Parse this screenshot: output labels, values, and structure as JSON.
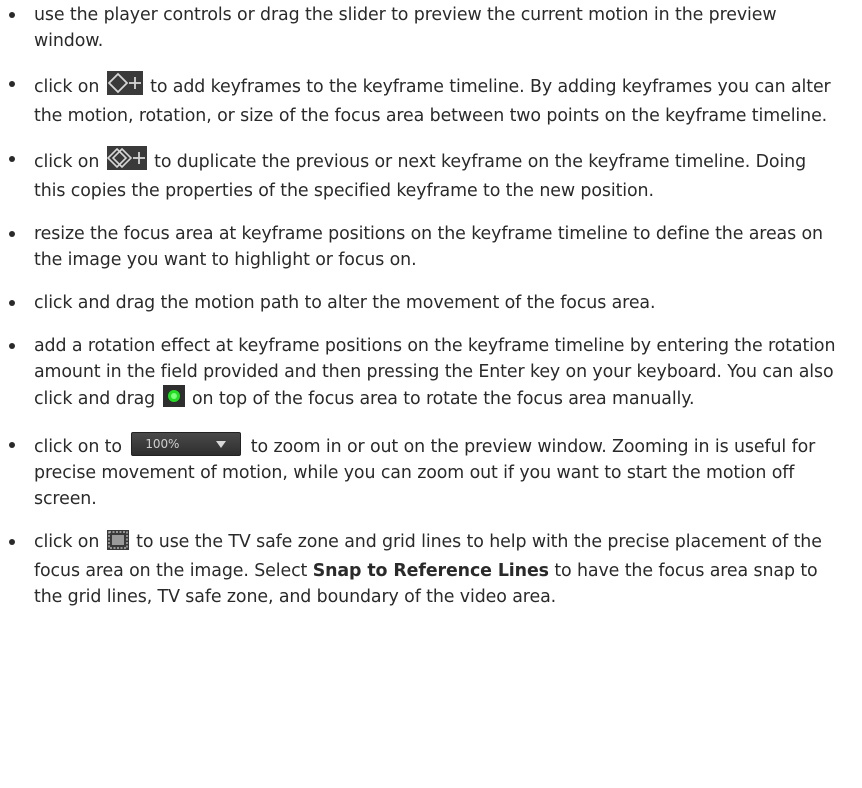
{
  "colors": {
    "text": "#2a2a2a",
    "icon_gray": "#d0d0d0",
    "icon_dark_bg": "#3a3a3a",
    "rotate_handle": "#22dd22"
  },
  "icons": {
    "add_keyframe": "add-keyframe-icon",
    "duplicate_keyframe": "duplicate-keyframe-icon",
    "rotate_handle": "rotate-handle-icon",
    "zoom_dropdown": "zoom-dropdown",
    "safe_zone": "tv-safe-zone-icon"
  },
  "bullets": [
    {
      "text": "use the player controls or drag the slider to preview the current motion in the preview window."
    },
    {
      "before": "click on ",
      "after": " to add keyframes to the keyframe timeline. By adding keyframes you can alter the motion, rotation, or size of the focus area between two points on the keyframe timeline."
    },
    {
      "before": "click on ",
      "after": " to duplicate the previous or next keyframe on the keyframe timeline. Doing this copies the properties of the specified keyframe to the new position."
    },
    {
      "text": "resize the focus area at keyframe positions on the keyframe timeline to define the areas on the image you want to highlight or focus on."
    },
    {
      "text": "click and drag the motion path to alter the movement of the focus area."
    },
    {
      "before": "add a rotation effect at keyframe positions on the keyframe timeline by entering the rotation amount in the field provided and then pressing the Enter key on your keyboard. You can also click and drag ",
      "after": " on top of the focus area to rotate the focus area manually."
    },
    {
      "before": "click on to ",
      "zoom_value": "100%",
      "after": " to zoom in or out on the preview window. Zooming in is useful for precise movement of motion, while you can zoom out if you want to start the motion off screen."
    },
    {
      "before": "click on ",
      "middle": " to use the TV safe zone and grid lines to help with the precise placement of the focus area on the image. Select ",
      "bold": "Snap to Reference Lines",
      "after": " to have the focus area snap to the grid lines, TV safe zone, and boundary of the video area."
    }
  ]
}
